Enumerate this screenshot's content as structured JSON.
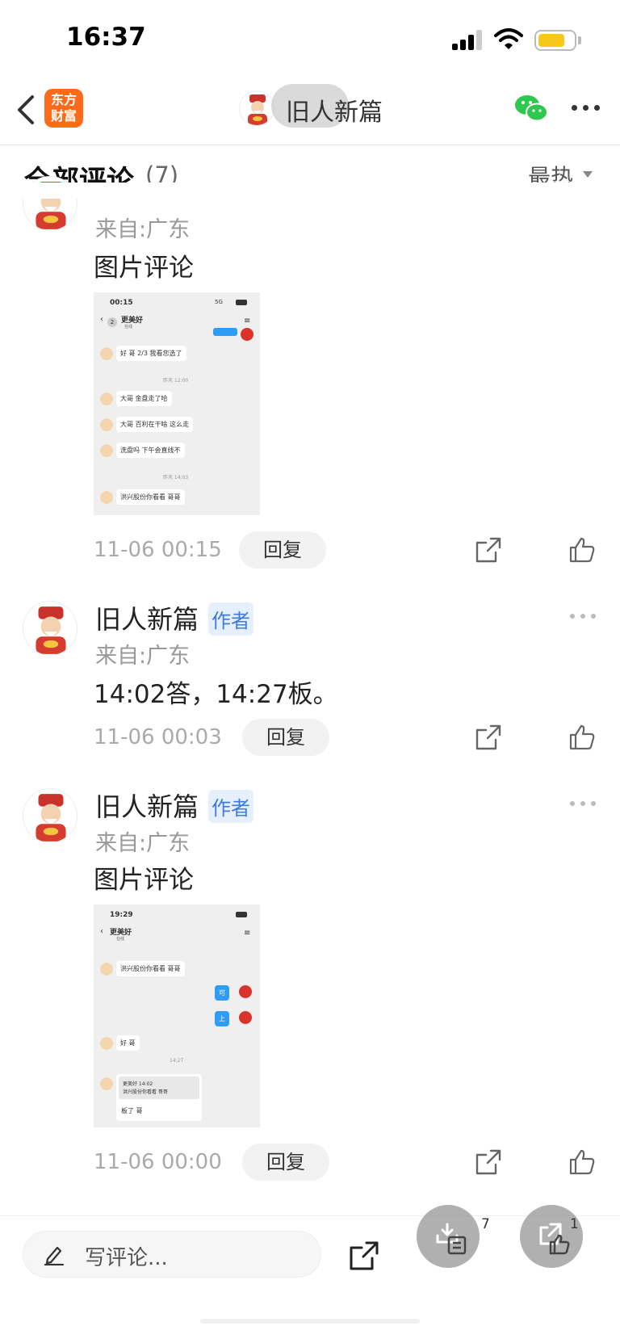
{
  "status_bar": {
    "time": "16:37"
  },
  "nav": {
    "back_label": "back",
    "app_logo_text": [
      "东方",
      "财富"
    ],
    "title": "旧人新篇"
  },
  "header": {
    "title": "全部评论",
    "count": "(7)",
    "sort_label": "最热"
  },
  "comments": [
    {
      "from": "来自:广东",
      "text": "图片评论",
      "has_image": true,
      "time": "11-06 00:15",
      "reply_label": "回复"
    },
    {
      "author": "旧人新篇",
      "badge": "作者",
      "from": "来自:广东",
      "text": "14:02答，14:27板。",
      "time": "11-06 00:03",
      "reply_label": "回复"
    },
    {
      "author": "旧人新篇",
      "badge": "作者",
      "from": "来自:广东",
      "text": "图片评论",
      "has_image": true,
      "time": "11-06 00:00",
      "reply_label": "回复"
    }
  ],
  "shot1": {
    "time": "00:15",
    "signal": "5G",
    "contact": "更美好",
    "unread": "2",
    "status": "在线",
    "messages": [
      "好 哥 2/3 我看您选了",
      "大哥 金盘走了哈",
      "大哥 百利在干啥 这么走",
      "洗盘吗 下午会直线不",
      "洪兴股份你看看 哥哥"
    ],
    "stamps": [
      "昨天 12:00",
      "昨天 14:03"
    ]
  },
  "shot2": {
    "time": "19:29",
    "contact": "更美好",
    "status": "在线",
    "messages": [
      "洪兴股份你看看 哥哥",
      "好 哥"
    ],
    "my_messages": [
      "可",
      "上"
    ],
    "stamp": "14:27",
    "quote_head": "更美好 14:02",
    "quote_body": "洪兴股份你看看 哥哥",
    "quote_reply": "板了 哥"
  },
  "bottom_bar": {
    "input_placeholder": "写评论...",
    "collect_count": "7",
    "share_count": "1"
  },
  "colors": {
    "brand_orange": "#ff6a1a",
    "author_badge": "#3d7be0",
    "wechat_green": "#2dc84d",
    "battery_yellow": "#f7c81b"
  }
}
